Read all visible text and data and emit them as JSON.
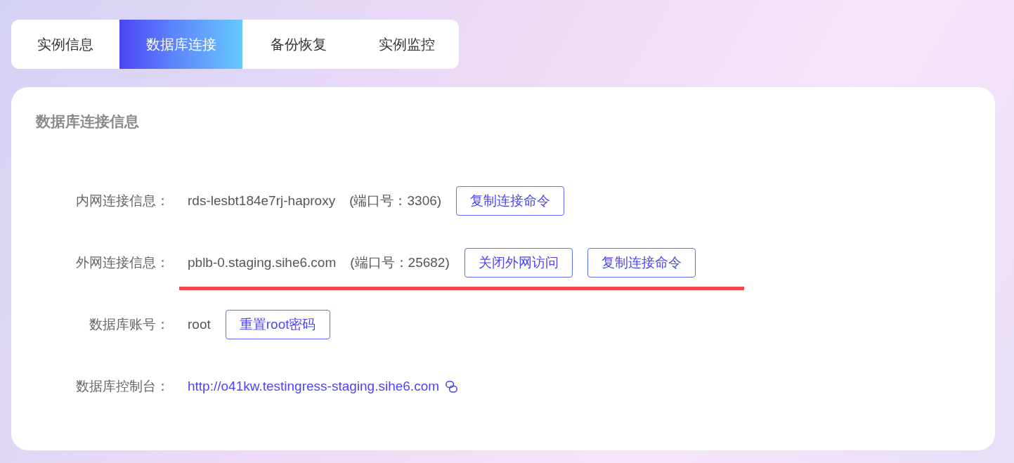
{
  "tabs": [
    {
      "label": "实例信息",
      "selected": false
    },
    {
      "label": "数据库连接",
      "selected": true
    },
    {
      "label": "备份恢复",
      "selected": false
    },
    {
      "label": "实例监控",
      "selected": false
    }
  ],
  "card": {
    "title": "数据库连接信息",
    "rows": [
      {
        "kind": "text",
        "label": "内网连接信息：",
        "value": "rds-lesbt184e7rj-haproxy",
        "port": "(端口号：3306)",
        "buttons": [
          "复制连接命令"
        ],
        "underlined": false
      },
      {
        "kind": "text",
        "label": "外网连接信息：",
        "value": "pblb-0.staging.sihe6.com",
        "port": "(端口号：25682)",
        "buttons": [
          "关闭外网访问",
          "复制连接命令"
        ],
        "underlined": true
      },
      {
        "kind": "text",
        "label": "数据库账号：",
        "value": "root",
        "buttons": [
          "重置root密码"
        ],
        "underlined": false
      },
      {
        "kind": "link",
        "label": "数据库控制台：",
        "value": "http://o41kw.testingress-staging.sihe6.com",
        "underlined": false
      }
    ]
  }
}
